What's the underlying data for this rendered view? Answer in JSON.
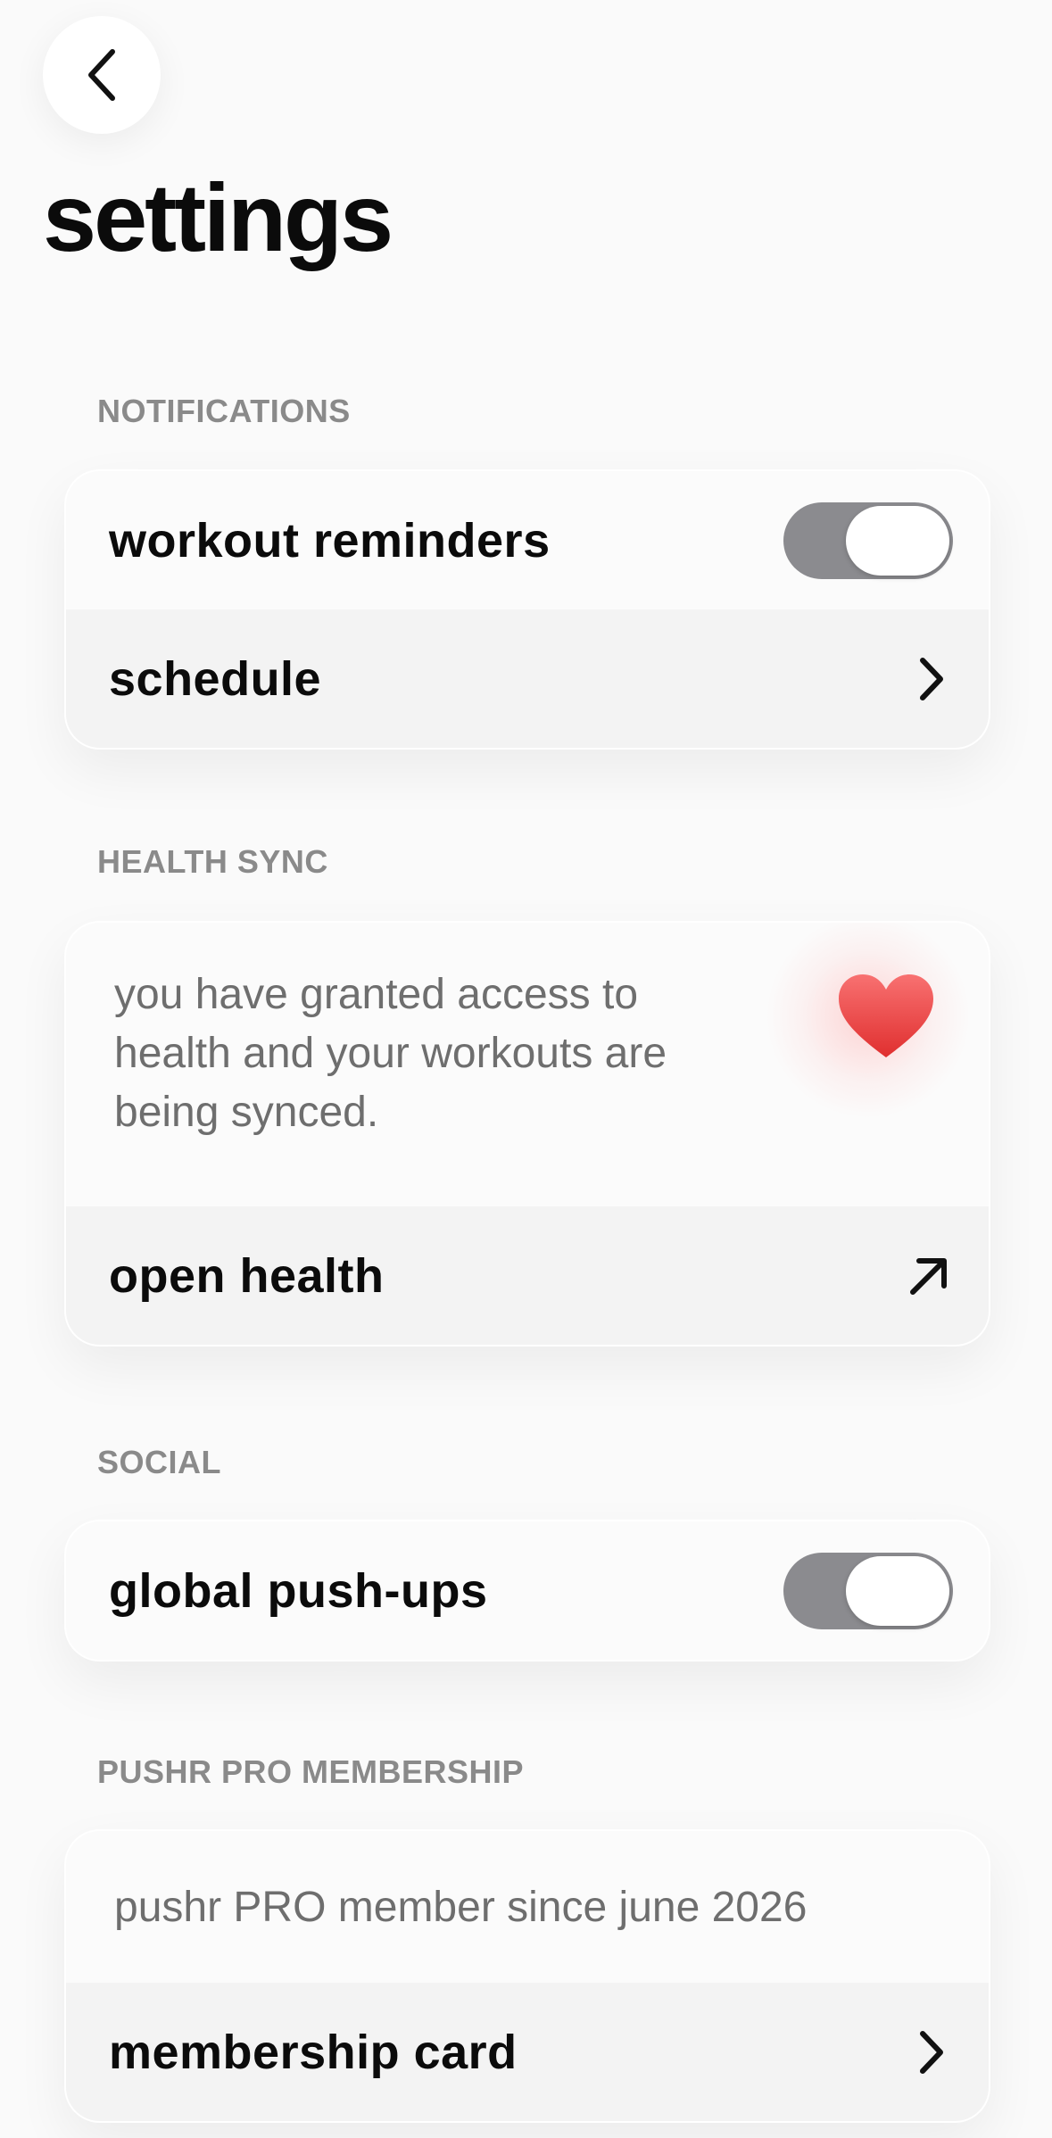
{
  "header": {
    "title": "settings"
  },
  "notifications": {
    "section_label": "NOTIFICATIONS",
    "workout_reminders_label": "workout reminders",
    "schedule_label": "schedule"
  },
  "health_sync": {
    "section_label": "HEALTH SYNC",
    "info_text": "you have granted access to health and your workouts are being synced.",
    "open_health_label": "open health"
  },
  "social": {
    "section_label": "SOCIAL",
    "global_pushups_label": "global push-ups"
  },
  "membership": {
    "section_label": "PUSHR PRO MEMBERSHIP",
    "member_since_text": "pushr PRO member since june 2026",
    "membership_card_label": "membership card"
  },
  "colors": {
    "toggle_track": "#8b8b8f",
    "heart": "#ef4444",
    "section_label": "#8a8a8a"
  },
  "icons": {
    "back": "chevron-left-icon",
    "schedule": "chevron-right-icon",
    "health": "heart-icon",
    "open_health": "arrow-up-right-icon",
    "membership_card": "chevron-right-icon"
  }
}
